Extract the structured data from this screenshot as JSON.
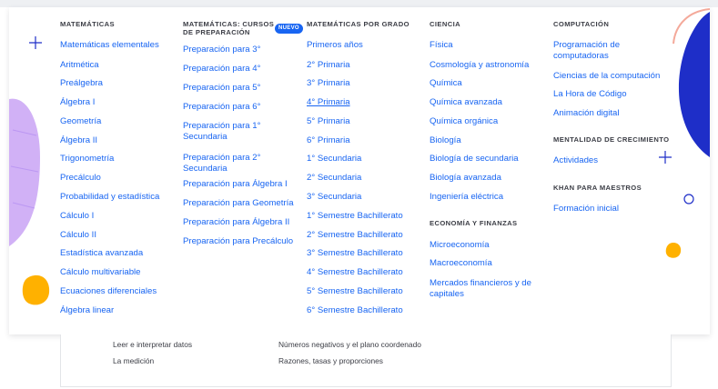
{
  "columns": {
    "math": {
      "heading": "MATEMÁTICAS",
      "links": [
        "Matemáticas elementales",
        "Aritmética",
        "Preálgebra",
        "Álgebra I",
        "Geometría",
        "Álgebra II",
        "Trigonometría",
        "Precálculo",
        "Probabilidad y estadística",
        "Cálculo I",
        "Cálculo II",
        "Estadística avanzada",
        "Cálculo multivariable",
        "Ecuaciones diferenciales",
        "Álgebra linear"
      ]
    },
    "prep": {
      "heading": "MATEMÁTICAS: CURSOS DE PREPARACIÓN",
      "badge": "NUEVO",
      "links": [
        "Preparación para 3°",
        "Preparación para 4°",
        "Preparación para 5°",
        "Preparación para 6°",
        "Preparación para 1° Secundaria",
        "Preparación para 2° Secundaria",
        "Preparación para Álgebra I",
        "Preparación para Geometría",
        "Preparación para Álgebra II",
        "Preparación para Precálculo"
      ]
    },
    "grade": {
      "heading": "MATEMÁTICAS POR GRADO",
      "links": [
        "Primeros años",
        "2° Primaria",
        "3° Primaria",
        "4° Primaria",
        "5° Primaria",
        "6° Primaria",
        "1° Secundaria",
        "2° Secundaria",
        "3° Secundaria",
        "1° Semestre Bachillerato",
        "2° Semestre Bachillerato",
        "3° Semestre Bachillerato",
        "4° Semestre Bachillerato",
        "5° Semestre Bachillerato",
        "6° Semestre Bachillerato"
      ]
    },
    "science": {
      "heading": "CIENCIA",
      "links": [
        "Física",
        "Cosmología y astronomía",
        "Química",
        "Química avanzada",
        "Química orgánica",
        "Biología",
        "Biología de secundaria",
        "Biología avanzada",
        "Ingeniería eléctrica"
      ],
      "econ_heading": "ECONOMÍA Y FINANZAS",
      "econ_links": [
        "Microeconomía",
        "Macroeconomía",
        "Mercados financieros y de capitales"
      ]
    },
    "computing": {
      "heading": "COMPUTACIÓN",
      "links": [
        "Programación de computadoras",
        "Ciencias de la computación",
        "La Hora de Código",
        "Animación digital"
      ],
      "growth_heading": "MENTALIDAD DE CRECIMIENTO",
      "growth_links": [
        "Actividades"
      ],
      "teachers_heading": "KHAN PARA MAESTROS",
      "teachers_links": [
        "Formación inicial"
      ]
    }
  },
  "below": {
    "items": [
      "Leer e interpretar datos",
      "Números negativos y el plano coordenado",
      "La medición",
      "Razones, tasas y proporciones"
    ]
  },
  "colors": {
    "link": "#1865f2",
    "heading": "#3b3d45",
    "purple": "#c9a3f5",
    "orange": "#ffb100",
    "navy": "#1e2ec8",
    "pink": "#f4a99a"
  }
}
